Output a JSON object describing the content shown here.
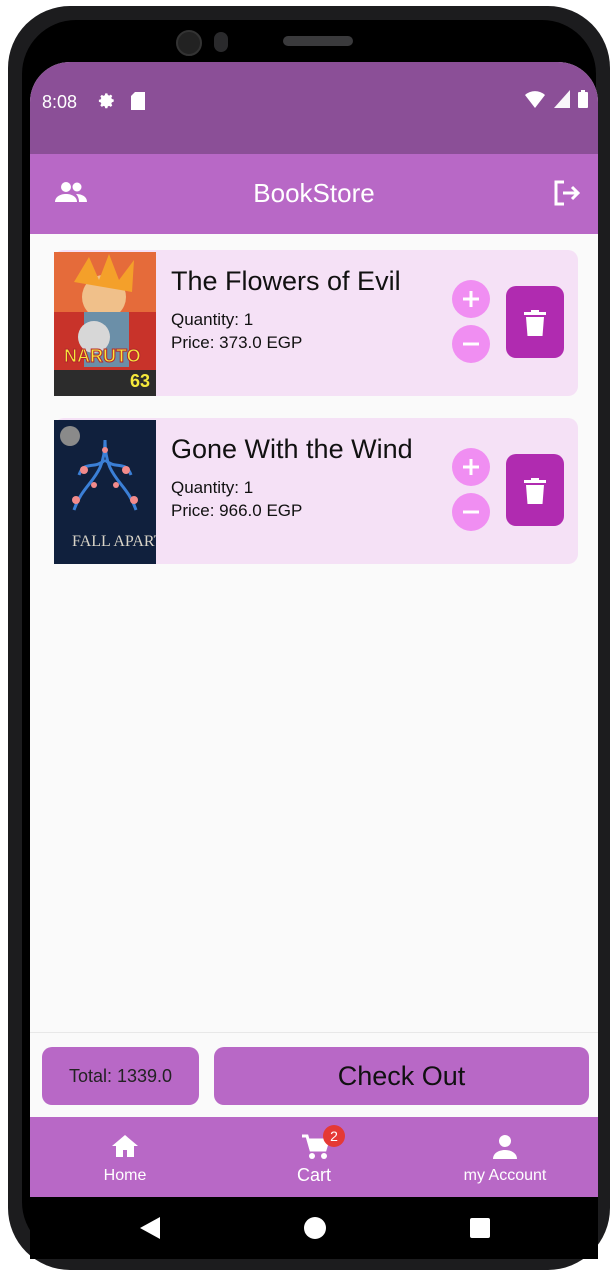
{
  "status_bar": {
    "time": "8:08"
  },
  "app_bar": {
    "title": "BookStore"
  },
  "cart": {
    "items": [
      {
        "title": "The Flowers of Evil",
        "quantity": "Quantity: 1",
        "price": "Price: 373.0 EGP",
        "cover_text": "NARUTO",
        "cover_volume": "63"
      },
      {
        "title": "Gone With the Wind",
        "quantity": "Quantity: 1",
        "price": "Price: 966.0 EGP",
        "cover_text": "FALL APART"
      }
    ]
  },
  "footer": {
    "total": "Total: 1339.0",
    "checkout_label": "Check Out"
  },
  "bottom_nav": {
    "items": [
      {
        "label": "Home",
        "icon": "home-icon"
      },
      {
        "label": "Cart",
        "icon": "cart-icon",
        "badge": "2"
      },
      {
        "label": "my Account",
        "icon": "person-icon"
      }
    ]
  },
  "colors": {
    "status_bar": "#8b4f97",
    "primary": "#b868c6",
    "item_bg": "#f5e1f6",
    "qty_button": "#f08ef2",
    "delete_button": "#b02bb0",
    "badge": "#e53935"
  }
}
